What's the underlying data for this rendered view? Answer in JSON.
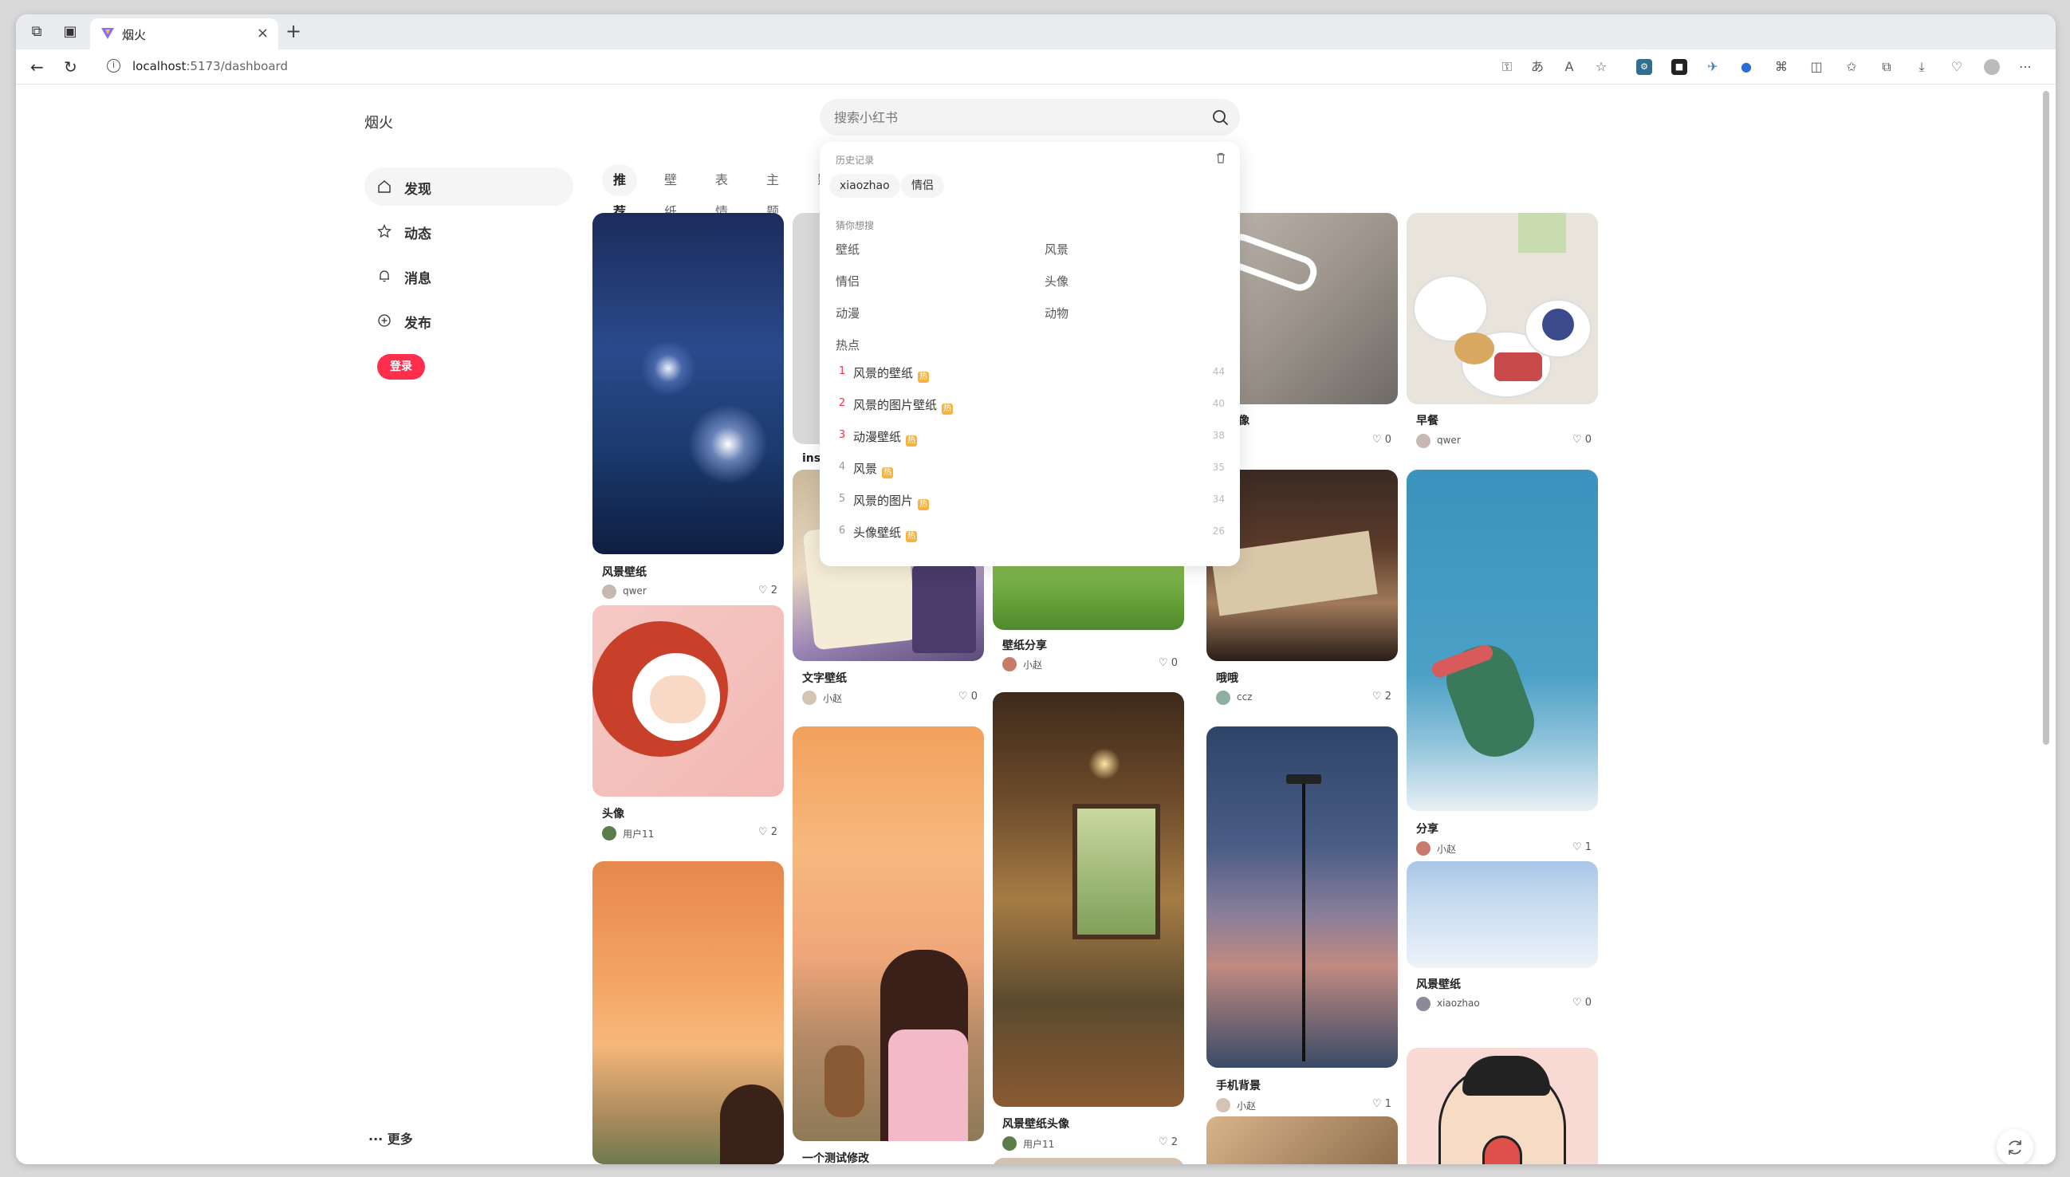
{
  "browser": {
    "tab_title": "烟火",
    "url_host": "localhost",
    "url_path": ":5173/dashboard"
  },
  "app": {
    "logo": "烟火",
    "search_placeholder": "搜索小红书"
  },
  "sidebar": {
    "items": [
      {
        "label": "发现",
        "icon": "home-icon"
      },
      {
        "label": "动态",
        "icon": "star-icon"
      },
      {
        "label": "消息",
        "icon": "bell-icon"
      },
      {
        "label": "发布",
        "icon": "plus-circle-icon"
      }
    ],
    "login_label": "登录",
    "more_label": "··· 更多"
  },
  "channels": [
    "推荐",
    "壁纸",
    "表情",
    "主题",
    "影"
  ],
  "search_dropdown": {
    "history_title": "历史记录",
    "history": [
      "xiaozhao",
      "情侣"
    ],
    "guess_title": "猜你想搜",
    "guess": [
      "壁纸",
      "风景",
      "情侣",
      "头像",
      "动漫",
      "动物"
    ],
    "hot_title": "热点",
    "hot": [
      {
        "rank": "1",
        "name": "风景的壁纸",
        "count": "44"
      },
      {
        "rank": "2",
        "name": "风景的图片壁纸",
        "count": "40"
      },
      {
        "rank": "3",
        "name": "动漫壁纸",
        "count": "38"
      },
      {
        "rank": "4",
        "name": "风景",
        "count": "35"
      },
      {
        "rank": "5",
        "name": "风景的图片",
        "count": "34"
      },
      {
        "rank": "6",
        "name": "头像壁纸",
        "count": "26"
      }
    ]
  },
  "feed": [
    {
      "title": "风景壁纸",
      "author": "qwer",
      "likes": "2"
    },
    {
      "title": "头像",
      "author": "用户11",
      "likes": "2"
    },
    {
      "title": "",
      "author": "",
      "likes": ""
    },
    {
      "title": "ins",
      "author": "",
      "likes": ""
    },
    {
      "title": "文字壁纸",
      "author": "小赵",
      "likes": "0"
    },
    {
      "title": "一个测试修改",
      "author": "",
      "likes": ""
    },
    {
      "title": "壁纸分享",
      "author": "小赵",
      "likes": "0"
    },
    {
      "title": "风景壁纸头像",
      "author": "用户11",
      "likes": "2"
    },
    {
      "title": "猫头像",
      "author": "",
      "likes": "0"
    },
    {
      "title": "哦哦",
      "author": "ccz",
      "likes": "2"
    },
    {
      "title": "手机背景",
      "author": "小赵",
      "likes": "1"
    },
    {
      "title": "早餐",
      "author": "qwer",
      "likes": "0"
    },
    {
      "title": "分享",
      "author": "小赵",
      "likes": "1"
    },
    {
      "title": "风景壁纸",
      "author": "xiaozhao",
      "likes": "0"
    }
  ],
  "colors": {
    "accent": "#ff2e4d",
    "hot_tag": "#f6b33f"
  }
}
